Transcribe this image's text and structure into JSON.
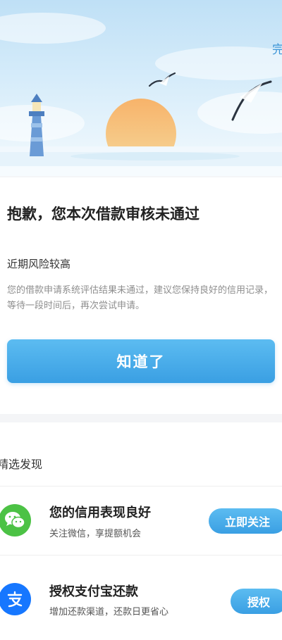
{
  "header": {
    "done_label": "完"
  },
  "result": {
    "title": "抱歉，您本次借款审核未通过",
    "risk_label": "近期风险较高",
    "description": "您的借款申请系统评估结果未通过，建议您保持良好的信用记录，等待一段时间后，再次尝试申请。",
    "ack_button": "知道了"
  },
  "discover": {
    "title": "精选发现",
    "items": [
      {
        "title": "您的信用表现良好",
        "subtitle": "关注微信，享提额机会",
        "button": "立即关注",
        "icon": "wechat-icon",
        "icon_color": "#4cc245"
      },
      {
        "title": "授权支付宝还款",
        "subtitle": "增加还款渠道，还款日更省心",
        "button": "授权",
        "icon": "alipay-icon",
        "icon_color": "#1677ff"
      }
    ]
  },
  "colors": {
    "accent": "#3a9fe3",
    "title_text": "#222222",
    "muted_text": "#8e8e8e"
  }
}
